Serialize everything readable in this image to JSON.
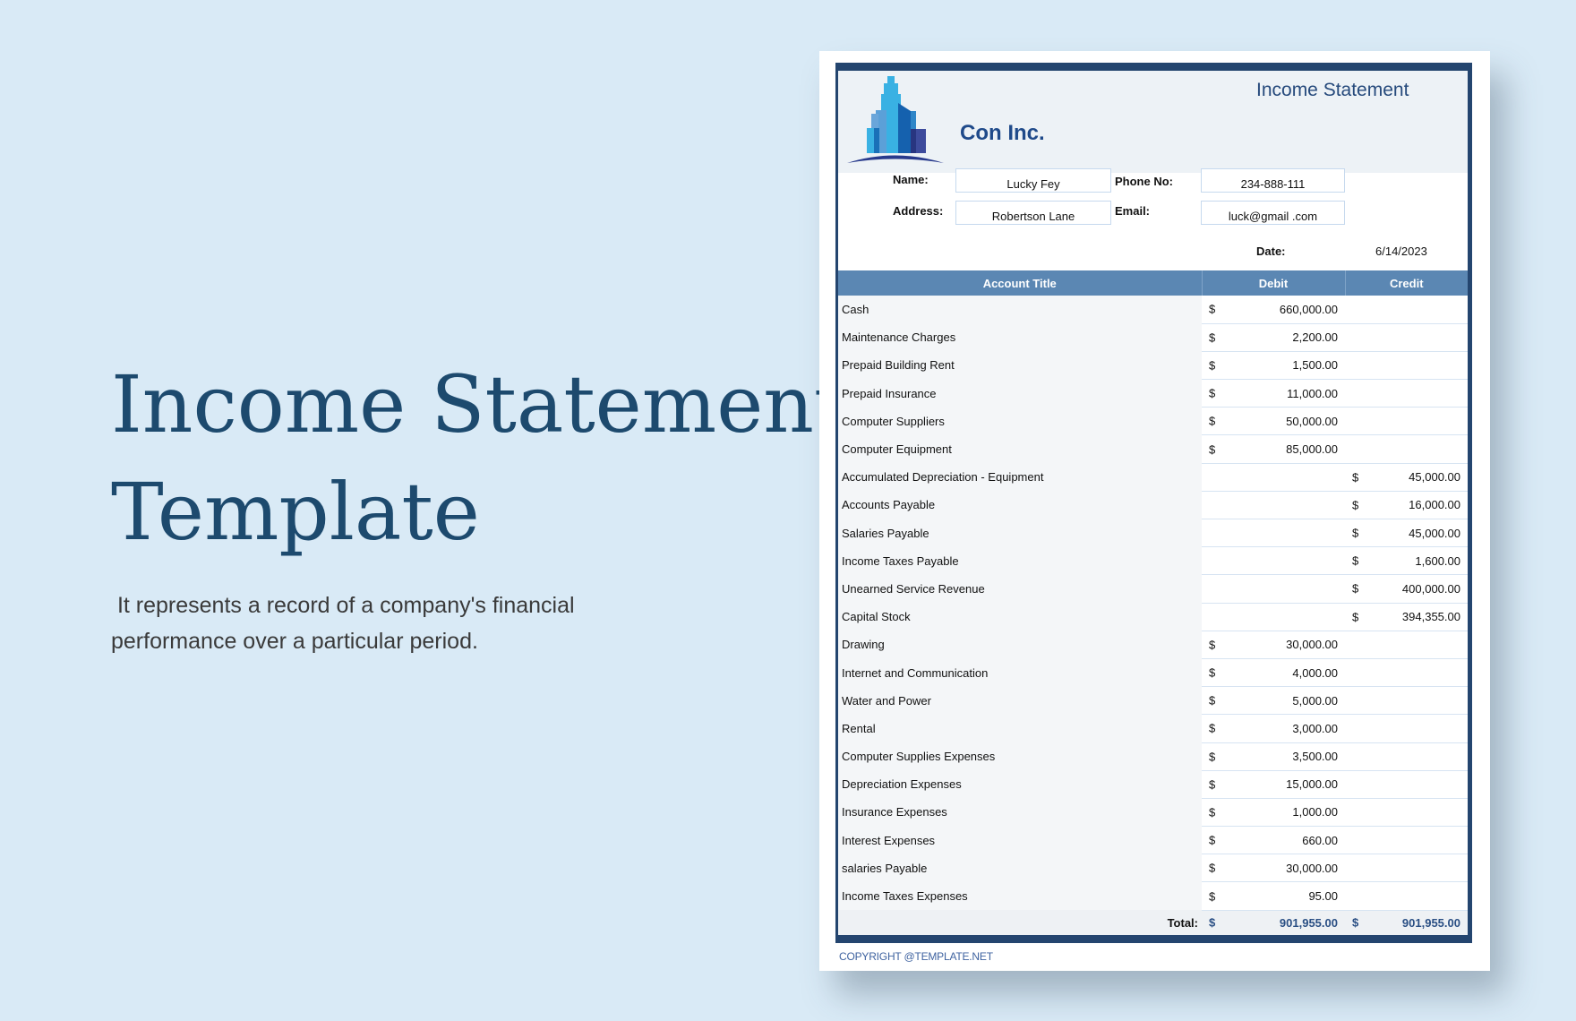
{
  "hero": {
    "title_line1": "Income Statement",
    "title_line2": "Template",
    "subtitle": " It represents a record of a company's financial performance over a particular period."
  },
  "document": {
    "company_name": "Con Inc.",
    "title": "Income Statement",
    "logo_icon": "city-buildings-icon",
    "colors": {
      "border": "#24456f",
      "header_band": "#edf2f6",
      "table_header": "#5b87b3",
      "company_text": "#1f4a8a",
      "total_text": "#2a4f84"
    },
    "fields": {
      "name_label": "Name:",
      "name_value": "Lucky Fey",
      "address_label": "Address:",
      "address_value": "Robertson Lane",
      "phone_label": "Phone No:",
      "phone_value": "234-888-111",
      "email_label": "Email:",
      "email_value": "luck@gmail .com",
      "date_label": "Date:",
      "date_value": "6/14/2023"
    },
    "table": {
      "columns": [
        "Account Title",
        "Debit",
        "Credit"
      ],
      "currency": "$",
      "rows": [
        {
          "account": "Cash",
          "debit": "660,000.00",
          "credit": ""
        },
        {
          "account": "Maintenance Charges",
          "debit": "2,200.00",
          "credit": ""
        },
        {
          "account": "Prepaid Building Rent",
          "debit": "1,500.00",
          "credit": ""
        },
        {
          "account": "Prepaid Insurance",
          "debit": "11,000.00",
          "credit": ""
        },
        {
          "account": "Computer Suppliers",
          "debit": "50,000.00",
          "credit": ""
        },
        {
          "account": "Computer Equipment",
          "debit": "85,000.00",
          "credit": ""
        },
        {
          "account": "Accumulated Depreciation - Equipment",
          "debit": "",
          "credit": "45,000.00"
        },
        {
          "account": "Accounts Payable",
          "debit": "",
          "credit": "16,000.00"
        },
        {
          "account": "Salaries Payable",
          "debit": "",
          "credit": "45,000.00"
        },
        {
          "account": "Income Taxes Payable",
          "debit": "",
          "credit": "1,600.00"
        },
        {
          "account": "Unearned Service Revenue",
          "debit": "",
          "credit": "400,000.00"
        },
        {
          "account": "Capital Stock",
          "debit": "",
          "credit": "394,355.00"
        },
        {
          "account": "Drawing",
          "debit": "30,000.00",
          "credit": ""
        },
        {
          "account": "Internet and Communication",
          "debit": "4,000.00",
          "credit": ""
        },
        {
          "account": "Water and Power",
          "debit": "5,000.00",
          "credit": ""
        },
        {
          "account": "Rental",
          "debit": "3,000.00",
          "credit": ""
        },
        {
          "account": "Computer Supplies Expenses",
          "debit": "3,500.00",
          "credit": ""
        },
        {
          "account": "Depreciation Expenses",
          "debit": "15,000.00",
          "credit": ""
        },
        {
          "account": "Insurance Expenses",
          "debit": "1,000.00",
          "credit": ""
        },
        {
          "account": "Interest Expenses",
          "debit": "660.00",
          "credit": ""
        },
        {
          "account": "salaries Payable",
          "debit": "30,000.00",
          "credit": ""
        },
        {
          "account": "Income Taxes Expenses",
          "debit": "95.00",
          "credit": ""
        }
      ],
      "total": {
        "label": "Total:",
        "debit": "901,955.00",
        "credit": "901,955.00"
      }
    },
    "copyright": "COPYRIGHT @TEMPLATE.NET"
  }
}
